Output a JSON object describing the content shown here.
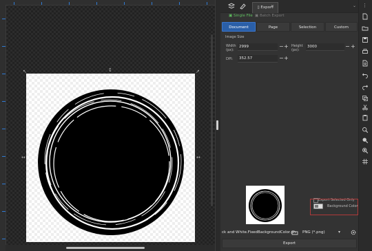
{
  "panel": {
    "tab_export": "Export",
    "tab_close": "✕",
    "single_file": "Single File",
    "batch_export": "Batch Export",
    "modes": [
      "Document",
      "Page",
      "Selection",
      "Custom"
    ],
    "image_size_heading": "Image Size",
    "width_label": "Width (px):",
    "width_value": "2999",
    "height_label": "Height (px):",
    "height_value": "3000",
    "dpi_label": "DPI:",
    "dpi_value": "352.57",
    "hide_selected_label": "Export Selected Only",
    "background_color_label": "Background Color",
    "filename": "ck and White.FixedBackgroundColor.png",
    "format": "PNG (*.png)",
    "export_button": "Export"
  },
  "colors": {
    "accent": "#2a5fa8",
    "single_file_green": "#5fbf5f",
    "highlight_red": "#b03a3a"
  },
  "icons": [
    "layers-icon",
    "brush-icon",
    "document-icon",
    "new-file-icon",
    "open-file-icon",
    "save-icon",
    "print-icon",
    "import-icon",
    "export-icon",
    "undo-icon",
    "redo-icon",
    "copy-icon",
    "cut-icon",
    "paste-icon",
    "zoom-icon",
    "zoom-drawing-icon",
    "zoom-page-icon",
    "grid-icon",
    "folder-icon",
    "gear-icon"
  ]
}
